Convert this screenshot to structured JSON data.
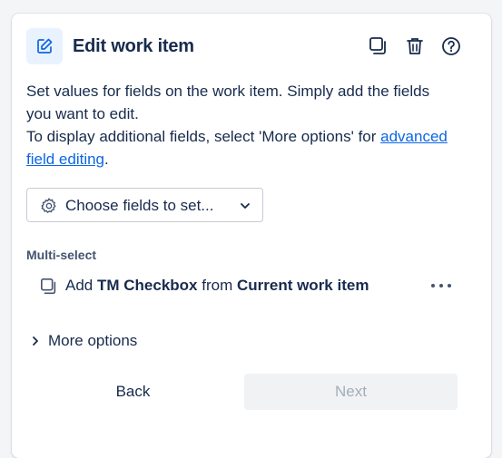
{
  "header": {
    "title": "Edit work item",
    "icon": "edit-icon",
    "actions": [
      {
        "name": "duplicate",
        "icon": "copy-icon"
      },
      {
        "name": "delete",
        "icon": "trash-icon"
      },
      {
        "name": "help",
        "icon": "help-icon"
      }
    ]
  },
  "description": {
    "line1": "Set values for fields on the work item. Simply add the fields you want to edit.",
    "line2_prefix": "To display additional fields, select 'More options' for ",
    "link": "advanced field editing",
    "line2_suffix": "."
  },
  "choose_fields": {
    "label": "Choose fields to set...",
    "icon": "gear-icon"
  },
  "multi_select": {
    "section_label": "Multi-select",
    "row": {
      "prefix": "Add ",
      "field": "TM Checkbox",
      "middle": " from ",
      "source": "Current work item",
      "icon": "copy-icon",
      "more_icon": "more-icon"
    }
  },
  "more_options": {
    "label": "More options"
  },
  "footer": {
    "back_label": "Back",
    "next_label": "Next"
  },
  "colors": {
    "accent": "#0c66e4",
    "icon_bg": "#e9f2ff",
    "disabled_text": "#a5adba"
  }
}
